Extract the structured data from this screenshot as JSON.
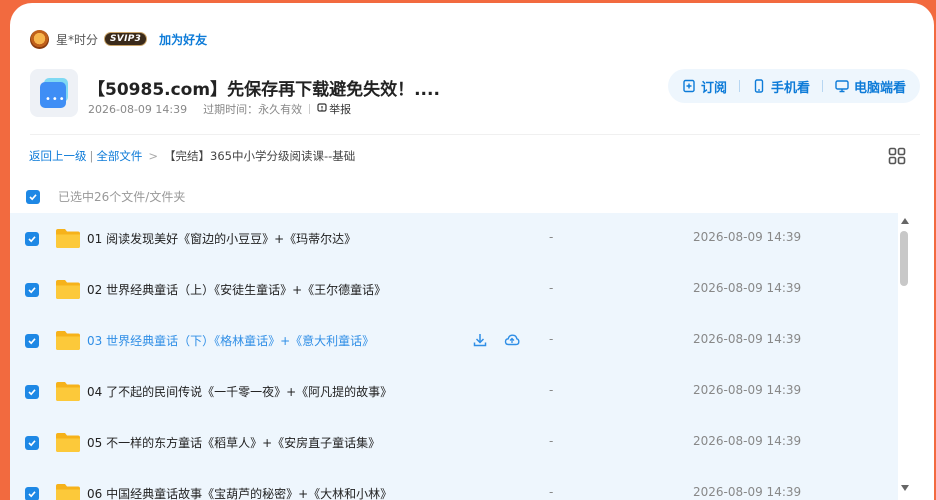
{
  "user": {
    "name": "星*时分",
    "badge": "SVIP3",
    "add_friend": "加为好友"
  },
  "share": {
    "title": "【50985.com】先保存再下载避免失效！....",
    "date": "2026-08-09 14:39",
    "expire_label": "过期时间：",
    "expire_value": "永久有效",
    "report": "举报"
  },
  "actions": {
    "subscribe": "订阅",
    "mobile": "手机看",
    "pc": "电脑端看"
  },
  "breadcrumb": {
    "back": "返回上一级",
    "all_files": "全部文件",
    "current": "【完结】365中小学分级阅读课--基础"
  },
  "selection": {
    "text": "已选中26个文件/文件夹"
  },
  "files": [
    {
      "name": "01 阅读发现美好《窗边的小豆豆》+《玛蒂尔达》",
      "size": "-",
      "date": "2026-08-09 14:39"
    },
    {
      "name": "02 世界经典童话（上）《安徒生童话》+《王尔德童话》",
      "size": "-",
      "date": "2026-08-09 14:39"
    },
    {
      "name": "03 世界经典童话（下）《格林童话》+《意大利童话》",
      "size": "-",
      "date": "2026-08-09 14:39"
    },
    {
      "name": "04 了不起的民间传说《一千零一夜》+《阿凡提的故事》",
      "size": "-",
      "date": "2026-08-09 14:39"
    },
    {
      "name": "05 不一样的东方童话《稻草人》+《安房直子童话集》",
      "size": "-",
      "date": "2026-08-09 14:39"
    },
    {
      "name": "06 中国经典童话故事《宝葫芦的秘密》+《大林和小林》",
      "size": "-",
      "date": "2026-08-09 14:39"
    }
  ],
  "colors": {
    "background": "#f26a3f",
    "accent": "#0d7bd8",
    "checkbox": "#1e88e5",
    "list_bg": "#eef6fd",
    "folder": "#fbc02d"
  },
  "icons": {
    "subscribe": "subscribe-icon",
    "mobile": "phone-icon",
    "pc": "monitor-icon",
    "grid": "grid-view-icon",
    "download": "download-icon",
    "save_cloud": "cloud-save-icon"
  }
}
